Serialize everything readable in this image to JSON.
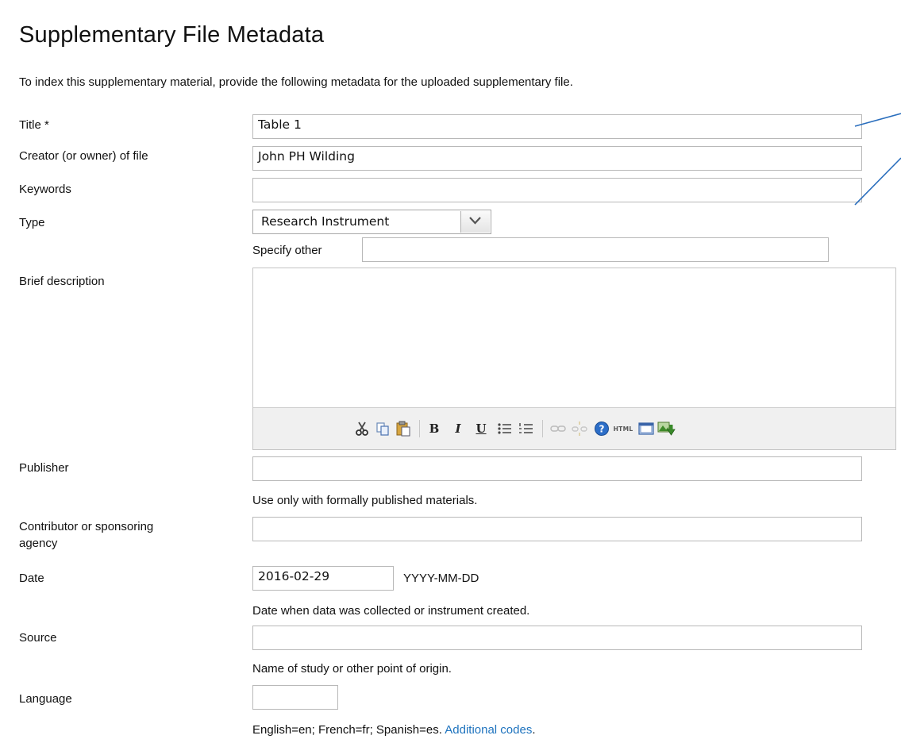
{
  "page": {
    "title": "Supplementary File Metadata",
    "intro": "To index this supplementary material, provide the following metadata for the uploaded supplementary file."
  },
  "fields": {
    "title": {
      "label": "Title *",
      "value": "Table 1"
    },
    "creator": {
      "label": "Creator (or owner) of file",
      "value": "John PH Wilding"
    },
    "keywords": {
      "label": "Keywords",
      "value": ""
    },
    "type": {
      "label": "Type",
      "value": "Research Instrument",
      "specify_other_label": "Specify other",
      "specify_other_value": ""
    },
    "description": {
      "label": "Brief description",
      "value": ""
    },
    "publisher": {
      "label": "Publisher",
      "value": "",
      "help": "Use only with formally published materials."
    },
    "contributor": {
      "label_line1": "Contributor or sponsoring",
      "label_line2": "agency",
      "value": ""
    },
    "date": {
      "label": "Date",
      "value": "2016-02-29",
      "format": "YYYY-MM-DD",
      "help": "Date when data was collected or instrument created."
    },
    "source": {
      "label": "Source",
      "value": "",
      "help": "Name of study or other point of origin."
    },
    "language": {
      "label": "Language",
      "value": "",
      "help": "English=en; French=fr; Spanish=es.",
      "help_link": "Additional codes",
      "help_end": "."
    }
  },
  "toolbar": {
    "bold": "B",
    "italic": "I",
    "underline": "U",
    "html": "HTML",
    "icons": [
      "cut-icon",
      "copy-icon",
      "paste-icon",
      "bold-icon",
      "italic-icon",
      "underline-icon",
      "bullet-list-icon",
      "numbered-list-icon",
      "link-icon",
      "unlink-icon",
      "help-icon",
      "html-icon",
      "fullscreen-icon",
      "insert-image-icon"
    ]
  },
  "colors": {
    "link": "#1e73be",
    "annotation_line": "#2a6ebd",
    "toolbar_bg": "#f0f0f0",
    "field_border": "#b8b8b8"
  }
}
